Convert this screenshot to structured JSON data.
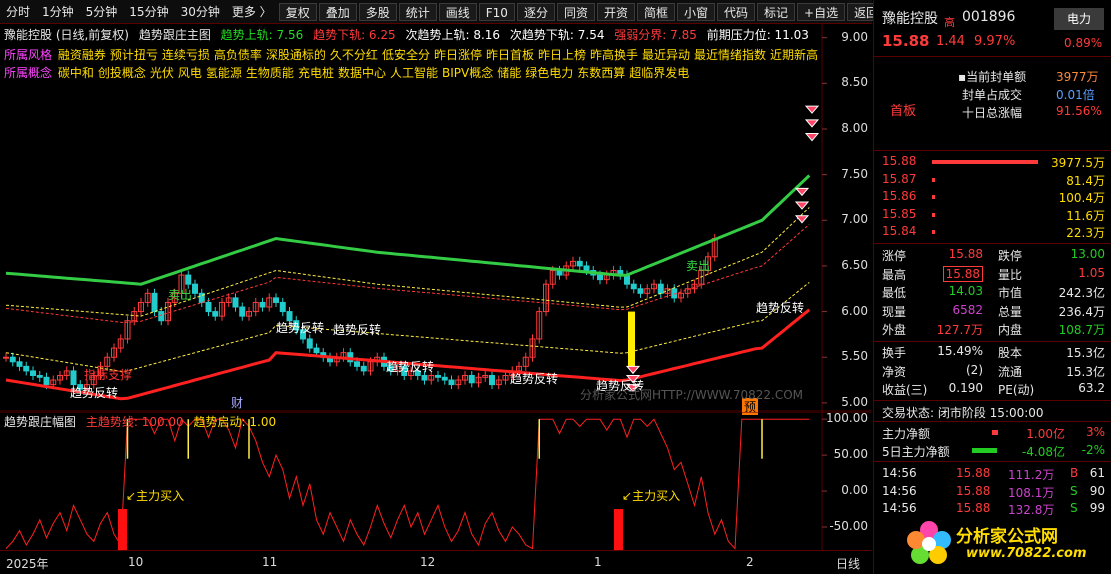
{
  "toolbar": {
    "periods": [
      "分时",
      "1分钟",
      "5分钟",
      "15分钟",
      "30分钟",
      "更多 〉"
    ],
    "buttons": [
      "复权",
      "叠加",
      "多股",
      "统计",
      "画线",
      "F10",
      "逐分",
      "同资",
      "开资",
      "简框",
      "小窗",
      "代码",
      "标记",
      "+自选",
      "返回"
    ]
  },
  "main": {
    "stock_label": "豫能控股 (日线,前复权)",
    "indicator_name": "趋势跟庄主图",
    "params": [
      {
        "label": "趋势上轨: 7.56",
        "color": "#22dd22"
      },
      {
        "label": "趋势下轨: 6.25",
        "color": "#ff3a3a"
      },
      {
        "label": "次趋势上轨: 8.16",
        "color": "#ffffff"
      },
      {
        "label": "次趋势下轨: 7.54",
        "color": "#ffffff"
      },
      {
        "label": "强弱分界: 7.85",
        "color": "#ff3a3a"
      },
      {
        "label": "前期压力位: 11.03",
        "color": "#ffffff"
      }
    ],
    "concept_row1_tag": "所属风格",
    "concept_row1": [
      "融资融券",
      "预计扭亏",
      "连续亏损",
      "高负债率",
      "深股通标的",
      "久不分红",
      "低安全分",
      "昨日涨停",
      "昨日首板",
      "昨日上榜",
      "昨高换手",
      "最近异动",
      "最近情绪指数",
      "近期新高"
    ],
    "concept_row2_tag": "所属概念",
    "concept_row2": [
      "碳中和",
      "创投概念",
      "光伏",
      "风电",
      "氢能源",
      "生物质能",
      "充电桩",
      "数据中心",
      "人工智能",
      "BIPV概念",
      "储能",
      "绿色电力",
      "东数西算",
      "超临界发电"
    ],
    "y_labels": [
      "9.00",
      "8.50",
      "8.00",
      "7.50",
      "7.00",
      "6.50",
      "6.00",
      "5.50",
      "5.00"
    ],
    "annotations": {
      "trend_reversal": "趋势反转",
      "sell": "卖出",
      "finance_mark": "财",
      "forecast_mark": "预",
      "indicator_support": "指标支撑",
      "watermark": "分析家公式网HTTP://WWW.70822.COM"
    }
  },
  "sub": {
    "indicator_name": "趋势跟庄幅图",
    "param1": "主趋势线: 100.00",
    "param2": "趋势启动: 1.00",
    "y_labels": [
      "100.00",
      "50.00",
      "0.00",
      "-50.00"
    ],
    "buy_label": "主力买入"
  },
  "dates": {
    "labels": [
      "2025年",
      "10",
      "11",
      "12",
      "1",
      "2"
    ],
    "period": "日线"
  },
  "side": {
    "name": "豫能控股",
    "code": "001896",
    "power_btn": "电力",
    "price": "15.88",
    "change": "1.44",
    "pct": "9.97%",
    "sector_pct": "0.89%",
    "high_mark": "高",
    "first_board": "首板",
    "seal_rows": [
      {
        "label": "当前封单额",
        "value": "3977万",
        "color": "#ff8a3a"
      },
      {
        "label": "封单占成交",
        "value": "0.01倍",
        "color": "#5aa0ff"
      },
      {
        "label": "十日总涨幅",
        "value": "91.56%",
        "color": "#ff3a3a"
      }
    ],
    "order_book": [
      {
        "price": "15.88",
        "vol": "3977.5万",
        "bar": 1.0
      },
      {
        "price": "15.87",
        "vol": "81.4万",
        "bar": 0.02
      },
      {
        "price": "15.86",
        "vol": "100.4万",
        "bar": 0.02
      },
      {
        "price": "15.85",
        "vol": "11.6万",
        "bar": 0.01
      },
      {
        "price": "15.84",
        "vol": "22.3万",
        "bar": 0.01
      }
    ],
    "stats": [
      {
        "l1": "涨停",
        "v1": "15.88",
        "c1": "#ff3a3a",
        "l2": "跌停",
        "v2": "13.00",
        "c2": "#22cc22"
      },
      {
        "l1": "最高",
        "v1": "15.88",
        "c1": "#ff3a3a",
        "l2": "量比",
        "v2": "1.05",
        "c2": "#ff3a3a"
      },
      {
        "l1": "最低",
        "v1": "14.03",
        "c1": "#22cc22",
        "l2": "市值",
        "v2": "242.3亿",
        "c2": "#e8e8e8"
      },
      {
        "l1": "现量",
        "v1": "6582",
        "c1": "#cc44cc",
        "l2": "总量",
        "v2": "236.4万",
        "c2": "#e8e8e8"
      },
      {
        "l1": "外盘",
        "v1": "127.7万",
        "c1": "#ff3a3a",
        "l2": "内盘",
        "v2": "108.7万",
        "c2": "#22cc22"
      }
    ],
    "stats2": [
      {
        "l1": "换手",
        "v1": "15.49%",
        "l2": "股本",
        "v2": "15.3亿"
      },
      {
        "l1": "净资",
        "v1": "(2)",
        "l2": "流通",
        "v2": "15.3亿"
      },
      {
        "l1": "收益(三)",
        "v1": "0.190",
        "l2": "PE(动)",
        "v2": "63.2"
      }
    ],
    "trade_state": "交易状态: 闭市阶段 15:00:00",
    "fund_rows": [
      {
        "label": "主力净额",
        "val": "1.00亿",
        "pct": "3%",
        "color": "#ff3a3a",
        "bar": 0.06
      },
      {
        "label": "5日主力净额",
        "val": "-4.08亿",
        "pct": "-2%",
        "color": "#22cc22",
        "bar": 0.25
      }
    ],
    "ticks": [
      {
        "time": "14:56",
        "price": "15.88",
        "vol": "111.2万",
        "side": "B",
        "n": "61"
      },
      {
        "time": "14:56",
        "price": "15.88",
        "vol": "108.1万",
        "side": "S",
        "n": "90"
      },
      {
        "time": "14:56",
        "price": "15.88",
        "vol": "132.8万",
        "side": "S",
        "n": "99"
      }
    ],
    "logo_text": "分析家公式网",
    "logo_url": "www.70822.com"
  },
  "colors": {
    "up": "#ff3a3a",
    "down": "#22cccc",
    "upper": "#33cc44",
    "lower": "#ff2020",
    "band": "#ffee44"
  }
}
